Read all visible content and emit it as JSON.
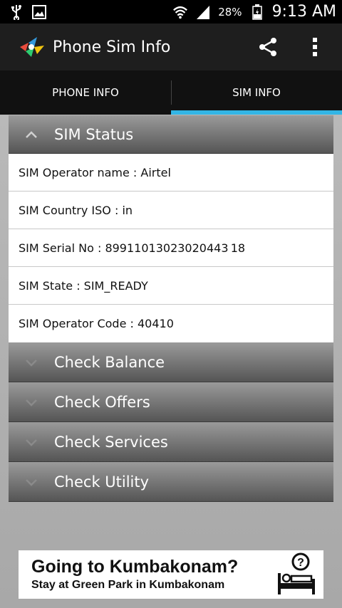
{
  "status_bar": {
    "battery_percent": "28%",
    "time": "9:13 AM",
    "icons": [
      "usb-icon",
      "image-icon",
      "wifi-icon",
      "signal-icon",
      "battery-icon"
    ]
  },
  "action_bar": {
    "title": "Phone Sim Info",
    "icons": [
      "app-logo-icon",
      "share-icon",
      "overflow-menu-icon"
    ]
  },
  "tabs": [
    {
      "label": "PHONE INFO",
      "active": false
    },
    {
      "label": "SIM INFO",
      "active": true
    }
  ],
  "groups": [
    {
      "title": "SIM Status",
      "expanded": true,
      "items": [
        "SIM Operator name : Airtel",
        "SIM Country ISO : in",
        "SIM Serial No : 89911013023020443 18",
        "SIM State : SIM_READY",
        "SIM Operator Code : 40410"
      ]
    },
    {
      "title": "Check Balance",
      "expanded": false
    },
    {
      "title": "Check Offers",
      "expanded": false
    },
    {
      "title": "Check Services",
      "expanded": false
    },
    {
      "title": "Check Utility",
      "expanded": false
    }
  ],
  "ad": {
    "headline": "Going to Kumbakonam?",
    "subline": "Stay at Green Park in Kumbakonam",
    "icon": "hotel-bed-help-icon"
  },
  "colors": {
    "tab_indicator": "#33b5e5",
    "action_bar": "#1e1e1e"
  }
}
